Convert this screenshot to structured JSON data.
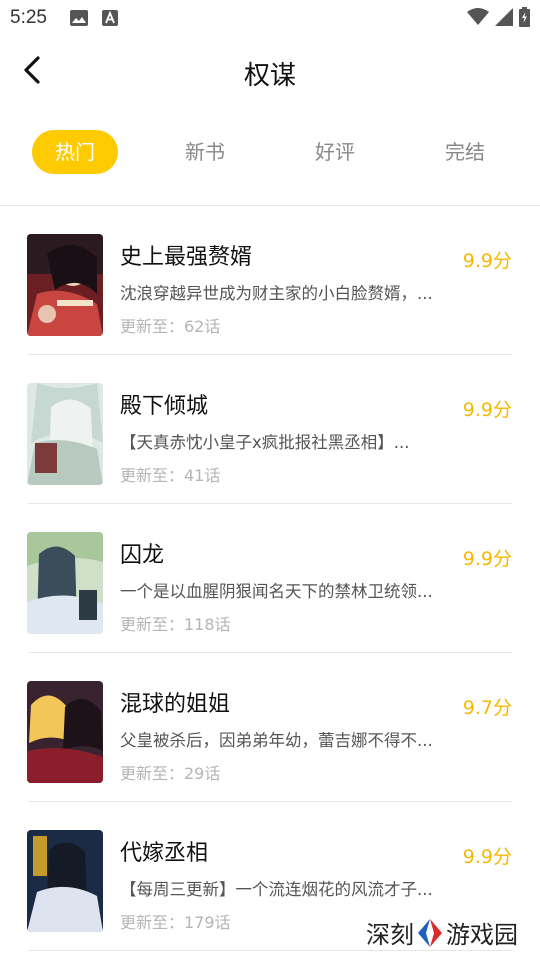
{
  "status": {
    "time": "5:25",
    "left_icons": [
      "image-icon",
      "notification-a-icon"
    ],
    "right_icons": [
      "wifi-icon",
      "signal-icon",
      "battery-icon"
    ]
  },
  "header": {
    "title": "权谋",
    "back_icon": "chevron-left-icon"
  },
  "tabs": [
    {
      "label": "热门",
      "active": true
    },
    {
      "label": "新书",
      "active": false
    },
    {
      "label": "好评",
      "active": false
    },
    {
      "label": "完结",
      "active": false
    }
  ],
  "colors": {
    "accent": "#fecb02",
    "score": "#f5b800"
  },
  "items": [
    {
      "title": "史上最强赘婿",
      "desc": "沈浪穿越异世成为财主家的小白脸赘婿，...",
      "update": "更新至：62话",
      "score": "9.9分"
    },
    {
      "title": "殿下倾城",
      "desc": "【天真赤忱小皇子x疯批报社黑丞相】...",
      "update": "更新至：41话",
      "score": "9.9分"
    },
    {
      "title": "囚龙",
      "desc": "一个是以血腥阴狠闻名天下的禁林卫统领...",
      "update": "更新至：118话",
      "score": "9.9分"
    },
    {
      "title": "混球的姐姐",
      "desc": "父皇被杀后，因弟弟年幼，蕾吉娜不得不...",
      "update": "更新至：29话",
      "score": "9.7分"
    },
    {
      "title": "代嫁丞相",
      "desc": "【每周三更新】一个流连烟花的风流才子...",
      "update": "更新至：179话",
      "score": "9.9分"
    }
  ],
  "watermark": {
    "text_left": "深刻",
    "text_right": "游戏园"
  }
}
